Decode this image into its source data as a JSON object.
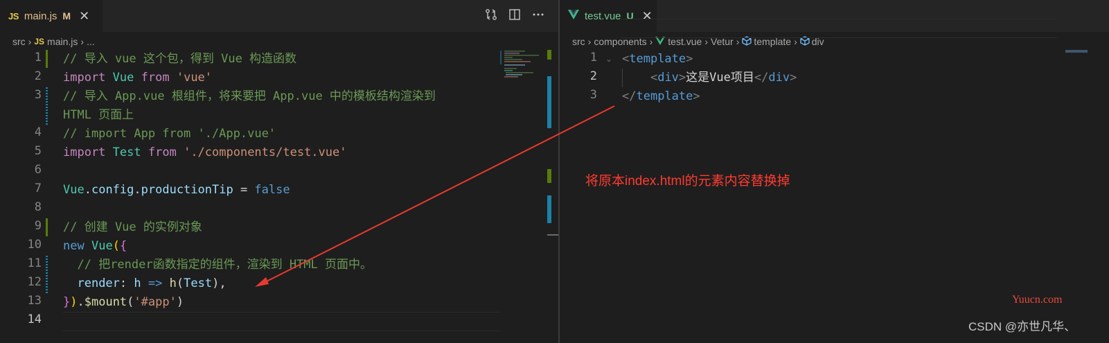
{
  "left": {
    "tab": {
      "lang": "JS",
      "name": "main.js",
      "status": "M"
    },
    "breadcrumb": {
      "folder": "src",
      "lang": "JS",
      "file": "main.js",
      "more": "..."
    },
    "lines": [
      {
        "n": "1",
        "tokens": [
          {
            "t": "// 导入 vue 这个包，得到 Vue 构造函数",
            "c": "cm"
          }
        ]
      },
      {
        "n": "2",
        "tokens": [
          {
            "t": "import",
            "c": "kw"
          },
          {
            "t": " "
          },
          {
            "t": "Vue",
            "c": "cl"
          },
          {
            "t": " "
          },
          {
            "t": "from",
            "c": "kw"
          },
          {
            "t": " "
          },
          {
            "t": "'vue'",
            "c": "st"
          }
        ]
      },
      {
        "n": "3",
        "tokens": [
          {
            "t": "// 导入 App.vue 根组件，将来要把 App.vue 中的模板结构渲染到",
            "c": "cm"
          }
        ]
      },
      {
        "n": "",
        "tokens": [
          {
            "t": "HTML 页面上",
            "c": "cm"
          }
        ]
      },
      {
        "n": "4",
        "tokens": [
          {
            "t": "// import App from './App.vue'",
            "c": "cm"
          }
        ]
      },
      {
        "n": "5",
        "tokens": [
          {
            "t": "import",
            "c": "kw"
          },
          {
            "t": " "
          },
          {
            "t": "Test",
            "c": "cl"
          },
          {
            "t": " "
          },
          {
            "t": "from",
            "c": "kw"
          },
          {
            "t": " "
          },
          {
            "t": "'./components/test.vue'",
            "c": "st"
          }
        ]
      },
      {
        "n": "6",
        "tokens": []
      },
      {
        "n": "7",
        "tokens": [
          {
            "t": "Vue",
            "c": "cl"
          },
          {
            "t": ".",
            "c": "pl"
          },
          {
            "t": "config",
            "c": "vr"
          },
          {
            "t": ".",
            "c": "pl"
          },
          {
            "t": "productionTip",
            "c": "vr"
          },
          {
            "t": " = ",
            "c": "op"
          },
          {
            "t": "false",
            "c": "bl"
          }
        ]
      },
      {
        "n": "8",
        "tokens": []
      },
      {
        "n": "9",
        "tokens": [
          {
            "t": "// 创建 Vue 的实例对象",
            "c": "cm"
          }
        ]
      },
      {
        "n": "10",
        "tokens": [
          {
            "t": "new",
            "c": "bl"
          },
          {
            "t": " "
          },
          {
            "t": "Vue",
            "c": "cl"
          },
          {
            "t": "(",
            "c": "br1"
          },
          {
            "t": "{",
            "c": "br2"
          }
        ]
      },
      {
        "n": "11",
        "tokens": [
          {
            "t": "  "
          },
          {
            "t": "// 把render函数指定的组件，渲染到 HTML 页面中。",
            "c": "cm"
          }
        ]
      },
      {
        "n": "12",
        "tokens": [
          {
            "t": "  "
          },
          {
            "t": "render",
            "c": "vr"
          },
          {
            "t": ": ",
            "c": "pl"
          },
          {
            "t": "h",
            "c": "vr"
          },
          {
            "t": " "
          },
          {
            "t": "=>",
            "c": "bl"
          },
          {
            "t": " "
          },
          {
            "t": "h",
            "c": "fn"
          },
          {
            "t": "(",
            "c": "pl"
          },
          {
            "t": "Test",
            "c": "vr"
          },
          {
            "t": "),",
            "c": "pl"
          }
        ]
      },
      {
        "n": "13",
        "tokens": [
          {
            "t": "}",
            "c": "br2"
          },
          {
            "t": ")",
            "c": "br1"
          },
          {
            "t": ".",
            "c": "pl"
          },
          {
            "t": "$mount",
            "c": "fn"
          },
          {
            "t": "(",
            "c": "pl"
          },
          {
            "t": "'#app'",
            "c": "st"
          },
          {
            "t": ")",
            "c": "pl"
          }
        ]
      },
      {
        "n": "14",
        "tokens": [],
        "active": true
      }
    ]
  },
  "right": {
    "tab": {
      "name": "test.vue",
      "status": "U"
    },
    "breadcrumb": {
      "folder1": "src",
      "folder2": "components",
      "file": "test.vue",
      "vetur": "Vetur",
      "template": "template",
      "div": "div"
    },
    "lines": [
      {
        "n": "1",
        "tokens": [
          {
            "t": "<",
            "c": "ang"
          },
          {
            "t": "template",
            "c": "tg"
          },
          {
            "t": ">",
            "c": "ang"
          }
        ]
      },
      {
        "n": "2",
        "tokens": [
          {
            "t": "    "
          },
          {
            "t": "<",
            "c": "ang"
          },
          {
            "t": "div",
            "c": "tg"
          },
          {
            "t": ">",
            "c": "ang"
          },
          {
            "t": "这是Vue项目",
            "c": "pl"
          },
          {
            "t": "</",
            "c": "ang"
          },
          {
            "t": "div",
            "c": "tg"
          },
          {
            "t": ">",
            "c": "ang"
          }
        ],
        "active": true
      },
      {
        "n": "3",
        "tokens": [
          {
            "t": "</",
            "c": "ang"
          },
          {
            "t": "template",
            "c": "tg"
          },
          {
            "t": ">",
            "c": "ang"
          }
        ]
      }
    ]
  },
  "annotation": {
    "text": "将原本index.html的元素内容替换掉",
    "color": "#ff3b30"
  },
  "watermark": {
    "site": "Yuucn.com",
    "author": "CSDN @亦世凡华、"
  },
  "colors": {
    "js_badge": "#e6c84d",
    "vue_logo": "#41b883",
    "modified": "#e2c08d",
    "untracked": "#73c991",
    "arrow": "#e83a2e"
  }
}
